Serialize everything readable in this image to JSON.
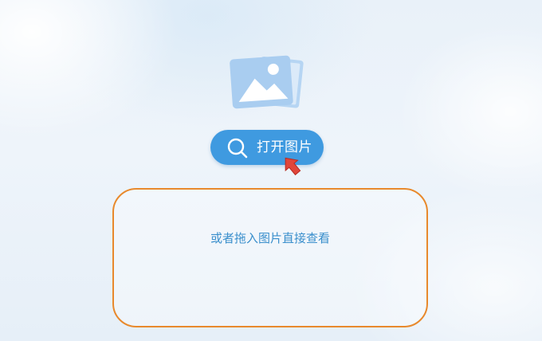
{
  "open_button": {
    "label": "打开图片",
    "icon": "search-icon"
  },
  "drop_zone": {
    "hint": "或者拖入图片直接查看"
  },
  "icons": {
    "illustration": "photo-stack-icon",
    "pointer": "cursor-arrow-icon"
  },
  "colors": {
    "button": "#3f9ae0",
    "drop_border": "#e8892c",
    "hint_text": "#3a8fcc",
    "photo_icon": "#a9cdf0",
    "cursor": "#e0463a"
  }
}
